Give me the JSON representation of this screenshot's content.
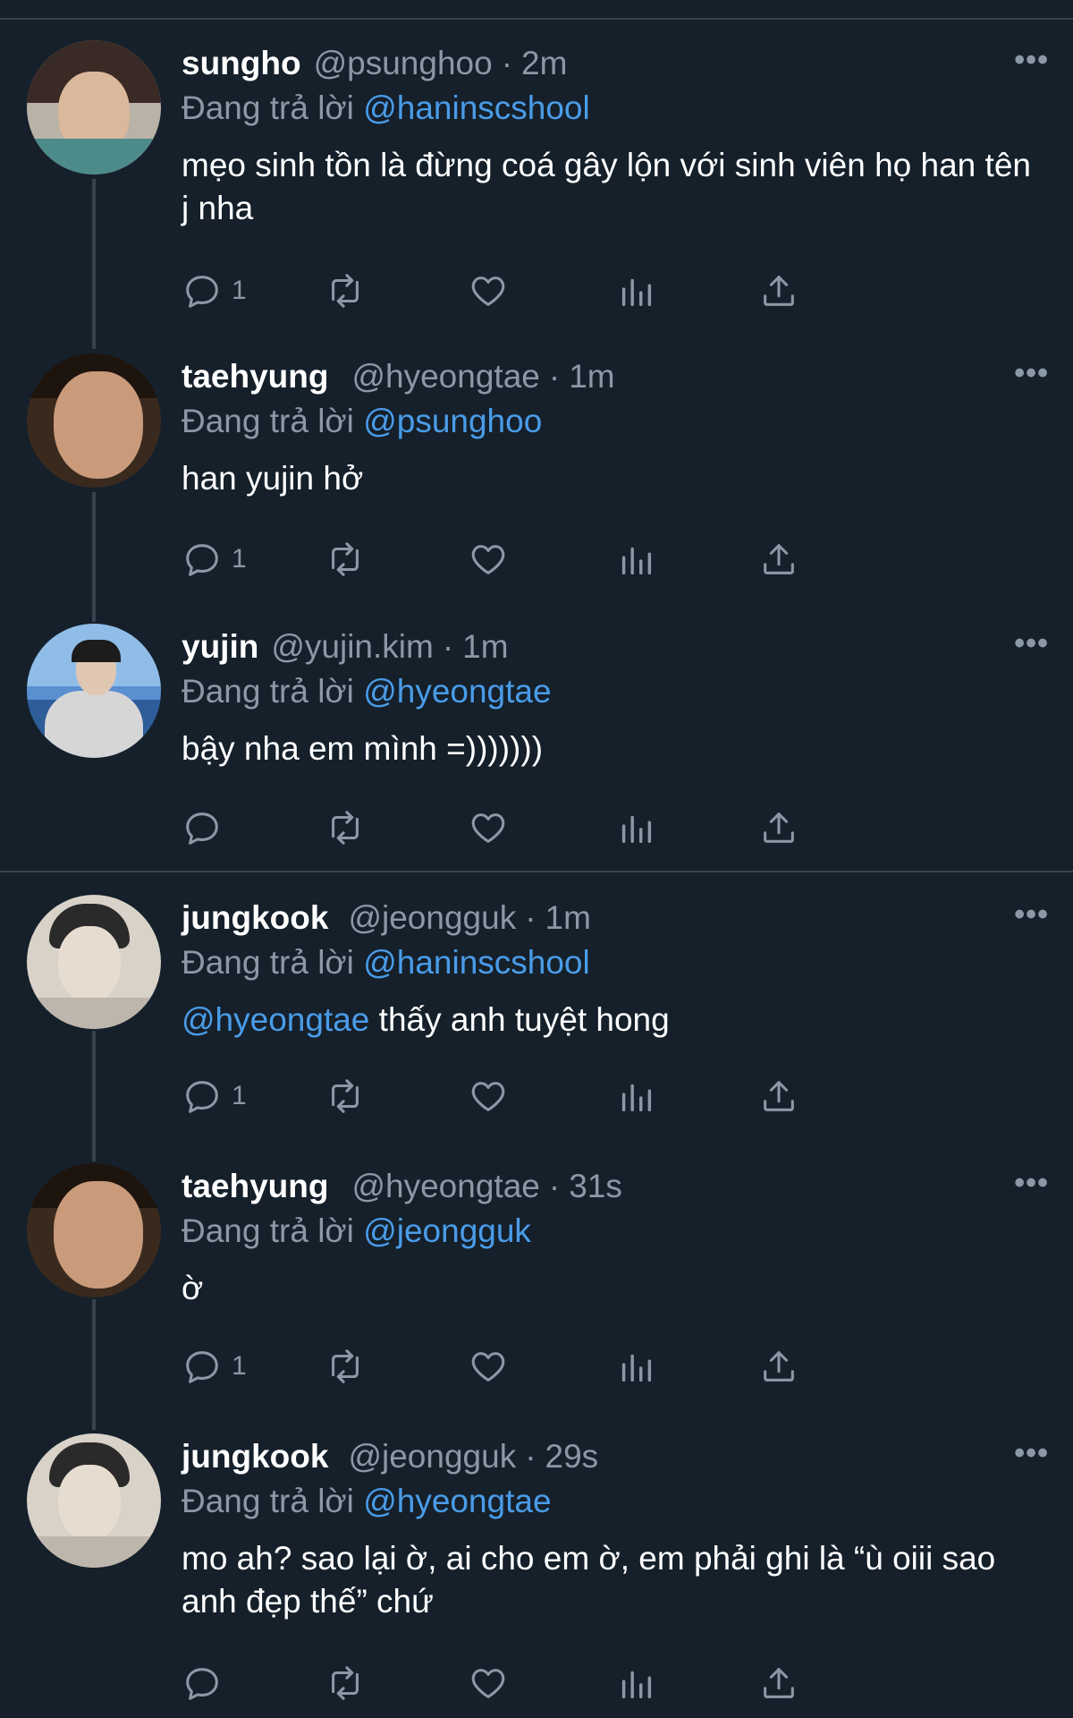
{
  "replying_label": "Đang trả lời",
  "tweets": [
    {
      "name": "sungho",
      "handle": "@psunghoo",
      "time": "2m",
      "reply_to": "@haninscshool",
      "mention": "",
      "text": "mẹo sinh tồn là đừng coá gây lộn với sinh viên họ han tên j nha",
      "reply_count": "1"
    },
    {
      "name": "taehyung",
      "handle": "@hyeongtae",
      "time": "1m",
      "reply_to": "@psunghoo",
      "mention": "",
      "text": "han yujin hở",
      "reply_count": "1"
    },
    {
      "name": "yujin",
      "handle": "@yujin.kim",
      "time": "1m",
      "reply_to": "@hyeongtae",
      "mention": "",
      "text": "bậy nha em mình =)))))))",
      "reply_count": ""
    },
    {
      "name": "jungkook",
      "handle": "@jeongguk",
      "time": "1m",
      "reply_to": "@haninscshool",
      "mention": "@hyeongtae",
      "text": " thấy anh tuyệt hong",
      "reply_count": "1"
    },
    {
      "name": "taehyung",
      "handle": "@hyeongtae",
      "time": "31s",
      "reply_to": "@jeongguk",
      "mention": "",
      "text": "ờ",
      "reply_count": "1"
    },
    {
      "name": "jungkook",
      "handle": "@jeongguk",
      "time": "29s",
      "reply_to": "@hyeongtae",
      "mention": "",
      "text": "mo ah? sao lại ờ, ai cho em ờ, em phải ghi là “ù oiii sao anh đẹp thế” chứ",
      "reply_count": ""
    }
  ],
  "icons": {
    "reply": "reply-icon",
    "retweet": "retweet-icon",
    "like": "heart-icon",
    "views": "views-chart-icon",
    "share": "share-icon",
    "more": "more-dots-icon"
  },
  "colors": {
    "background": "#15202b",
    "link": "#4a9ce8",
    "muted": "#8b98a5",
    "divider": "#38444d"
  }
}
